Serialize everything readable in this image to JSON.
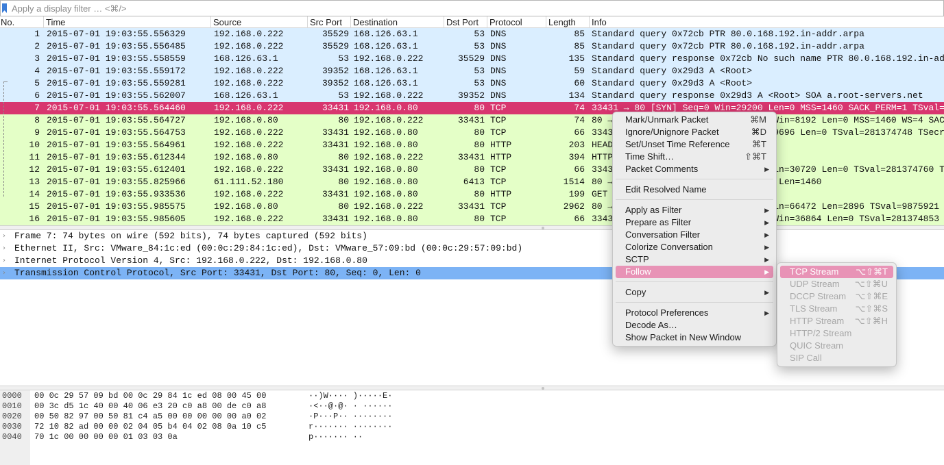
{
  "filter": {
    "placeholder": "Apply a display filter … <⌘/>"
  },
  "columns": [
    "No.",
    "Time",
    "Source",
    "Src Port",
    "Destination",
    "Dst Port",
    "Protocol",
    "Length",
    "Info"
  ],
  "packets": [
    {
      "no": "1",
      "time": "2015-07-01 19:03:55.556329",
      "src": "192.168.0.222",
      "sport": "35529",
      "dst": "168.126.63.1",
      "dport": "53",
      "proto": "DNS",
      "len": "85",
      "info": "Standard query 0x72cb PTR 80.0.168.192.in-addr.arpa",
      "kind": "dns"
    },
    {
      "no": "2",
      "time": "2015-07-01 19:03:55.556485",
      "src": "192.168.0.222",
      "sport": "35529",
      "dst": "168.126.63.1",
      "dport": "53",
      "proto": "DNS",
      "len": "85",
      "info": "Standard query 0x72cb PTR 80.0.168.192.in-addr.arpa",
      "kind": "dns"
    },
    {
      "no": "3",
      "time": "2015-07-01 19:03:55.558559",
      "src": "168.126.63.1",
      "sport": "53",
      "dst": "192.168.0.222",
      "dport": "35529",
      "proto": "DNS",
      "len": "135",
      "info": "Standard query response 0x72cb No such name PTR 80.0.168.192.in-add",
      "kind": "dns"
    },
    {
      "no": "4",
      "time": "2015-07-01 19:03:55.559172",
      "src": "192.168.0.222",
      "sport": "39352",
      "dst": "168.126.63.1",
      "dport": "53",
      "proto": "DNS",
      "len": "59",
      "info": "Standard query 0x29d3 A <Root>",
      "kind": "dns"
    },
    {
      "no": "5",
      "time": "2015-07-01 19:03:55.559281",
      "src": "192.168.0.222",
      "sport": "39352",
      "dst": "168.126.63.1",
      "dport": "53",
      "proto": "DNS",
      "len": "60",
      "info": "Standard query 0x29d3 A <Root>",
      "kind": "dns"
    },
    {
      "no": "6",
      "time": "2015-07-01 19:03:55.562007",
      "src": "168.126.63.1",
      "sport": "53",
      "dst": "192.168.0.222",
      "dport": "39352",
      "proto": "DNS",
      "len": "134",
      "info": "Standard query response 0x29d3 A <Root> SOA a.root-servers.net",
      "kind": "dns"
    },
    {
      "no": "7",
      "time": "2015-07-01 19:03:55.564460",
      "src": "192.168.0.222",
      "sport": "33431",
      "dst": "192.168.0.80",
      "dport": "80",
      "proto": "TCP",
      "len": "74",
      "info": "33431 → 80 [SYN] Seq=0 Win=29200 Len=0 MSS=1460 SACK_PERM=1 TSval=",
      "kind": "sel"
    },
    {
      "no": "8",
      "time": "2015-07-01 19:03:55.564727",
      "src": "192.168.0.80",
      "sport": "80",
      "dst": "192.168.0.222",
      "dport": "33431",
      "proto": "TCP",
      "len": "74",
      "info": "80 → 33431 [SYN, ACK] Seq=0 Ack=1 Win=8192 Len=0 MSS=1460 WS=4 SAC",
      "kind": "tcp"
    },
    {
      "no": "9",
      "time": "2015-07-01 19:03:55.564753",
      "src": "192.168.0.222",
      "sport": "33431",
      "dst": "192.168.0.80",
      "dport": "80",
      "proto": "TCP",
      "len": "66",
      "info": "33431 → 80 [ACK] Seq=1 Ack=1 Win=29696 Len=0 TSval=281374748 TSecr",
      "kind": "tcp"
    },
    {
      "no": "10",
      "time": "2015-07-01 19:03:55.564961",
      "src": "192.168.0.222",
      "sport": "33431",
      "dst": "192.168.0.80",
      "dport": "80",
      "proto": "HTTP",
      "len": "203",
      "info": "HEAD",
      "kind": "http"
    },
    {
      "no": "11",
      "time": "2015-07-01 19:03:55.612344",
      "src": "192.168.0.80",
      "sport": "80",
      "dst": "192.168.0.222",
      "dport": "33431",
      "proto": "HTTP",
      "len": "394",
      "info": "HTTP",
      "kind": "http"
    },
    {
      "no": "12",
      "time": "2015-07-01 19:03:55.612401",
      "src": "192.168.0.222",
      "sport": "33431",
      "dst": "192.168.0.80",
      "dport": "80",
      "proto": "TCP",
      "len": "66",
      "info": "33431 → 80 [ACK] Seq=138 Ack=329 Win=30720 Len=0 TSval=281374760 T",
      "kind": "tcp"
    },
    {
      "no": "13",
      "time": "2015-07-01 19:03:55.825966",
      "src": "61.111.52.180",
      "sport": "80",
      "dst": "192.168.0.80",
      "dport": "6413",
      "proto": "TCP",
      "len": "1514",
      "info": "80 → 6413 [ACK] Seq=1 Ack=1 Win=14 Len=1460",
      "kind": "tcp"
    },
    {
      "no": "14",
      "time": "2015-07-01 19:03:55.933536",
      "src": "192.168.0.222",
      "sport": "33431",
      "dst": "192.168.0.80",
      "dport": "80",
      "proto": "HTTP",
      "len": "199",
      "info": "GET",
      "kind": "http"
    },
    {
      "no": "15",
      "time": "2015-07-01 19:03:55.985575",
      "src": "192.168.0.80",
      "sport": "80",
      "dst": "192.168.0.222",
      "dport": "33431",
      "proto": "TCP",
      "len": "2962",
      "info": "80 → 33431 [ACK] Seq=329 Ack=271 Win=66472 Len=2896 TSval=9875921",
      "kind": "tcp"
    },
    {
      "no": "16",
      "time": "2015-07-01 19:03:55.985605",
      "src": "192.168.0.222",
      "sport": "33431",
      "dst": "192.168.0.80",
      "dport": "80",
      "proto": "TCP",
      "len": "66",
      "info": "33431 → 80 [ACK] Seq=271 Ack=3225 Win=36864 Len=0 TSval=281374853",
      "kind": "tcp"
    }
  ],
  "details": [
    {
      "text": "Frame 7: 74 bytes on wire (592 bits), 74 bytes captured (592 bits)",
      "selected": false
    },
    {
      "text": "Ethernet II, Src: VMware_84:1c:ed (00:0c:29:84:1c:ed), Dst: VMware_57:09:bd (00:0c:29:57:09:bd)",
      "selected": false
    },
    {
      "text": "Internet Protocol Version 4, Src: 192.168.0.222, Dst: 192.168.0.80",
      "selected": false
    },
    {
      "text": "Transmission Control Protocol, Src Port: 33431, Dst Port: 80, Seq: 0, Len: 0",
      "selected": true
    }
  ],
  "bytes": [
    {
      "offset": "0000",
      "hex": "00 0c 29 57 09 bd 00 0c  29 84 1c ed 08 00 45 00",
      "ascii": "··)W····  )·····E·"
    },
    {
      "offset": "0010",
      "hex": "00 3c d5 1c 40 00 40 06  e3 20 c0 a8 00 de c0 a8",
      "ascii": "·<··@·@·  · ······"
    },
    {
      "offset": "0020",
      "hex": "00 50 82 97 00 50 81 c4  a5 00 00 00 00 00 a0 02",
      "ascii": "·P···P··  ········"
    },
    {
      "offset": "0030",
      "hex": "72 10 82 ad 00 00 02 04  05 b4 04 02 08 0a 10 c5",
      "ascii": "r·······  ········"
    },
    {
      "offset": "0040",
      "hex": "70 1c 00 00 00 00 01 03  03 0a",
      "ascii": "p·······  ··"
    }
  ],
  "context_menu": [
    {
      "label": "Mark/Unmark Packet",
      "shortcut": "⌘M"
    },
    {
      "label": "Ignore/Unignore Packet",
      "shortcut": "⌘D"
    },
    {
      "label": "Set/Unset Time Reference",
      "shortcut": "⌘T"
    },
    {
      "label": "Time Shift…",
      "shortcut": "⇧⌘T"
    },
    {
      "label": "Packet Comments",
      "submenu": true
    },
    {
      "separator": true
    },
    {
      "label": "Edit Resolved Name"
    },
    {
      "separator": true
    },
    {
      "label": "Apply as Filter",
      "submenu": true
    },
    {
      "label": "Prepare as Filter",
      "submenu": true
    },
    {
      "label": "Conversation Filter",
      "submenu": true
    },
    {
      "label": "Colorize Conversation",
      "submenu": true
    },
    {
      "label": "SCTP",
      "submenu": true
    },
    {
      "label": "Follow",
      "submenu": true,
      "highlighted": true
    },
    {
      "separator": true
    },
    {
      "label": "Copy",
      "submenu": true
    },
    {
      "separator": true
    },
    {
      "label": "Protocol Preferences",
      "submenu": true
    },
    {
      "label": "Decode As…"
    },
    {
      "label": "Show Packet in New Window"
    }
  ],
  "follow_submenu": [
    {
      "label": "TCP Stream",
      "shortcut": "⌥⇧⌘T",
      "enabled": true,
      "highlighted": true
    },
    {
      "label": "UDP Stream",
      "shortcut": "⌥⇧⌘U",
      "enabled": false
    },
    {
      "label": "DCCP Stream",
      "shortcut": "⌥⇧⌘E",
      "enabled": false
    },
    {
      "label": "TLS Stream",
      "shortcut": "⌥⇧⌘S",
      "enabled": false
    },
    {
      "label": "HTTP Stream",
      "shortcut": "⌥⇧⌘H",
      "enabled": false
    },
    {
      "label": "HTTP/2 Stream",
      "enabled": false
    },
    {
      "label": "QUIC Stream",
      "enabled": false
    },
    {
      "label": "SIP Call",
      "enabled": false
    }
  ],
  "colors": {
    "dns_row": "#daeeff",
    "tcp_row": "#e4ffc7",
    "selected_row": "#d8366f",
    "selected_detail": "#7cb3f5",
    "menu_highlight": "#e893b6"
  }
}
